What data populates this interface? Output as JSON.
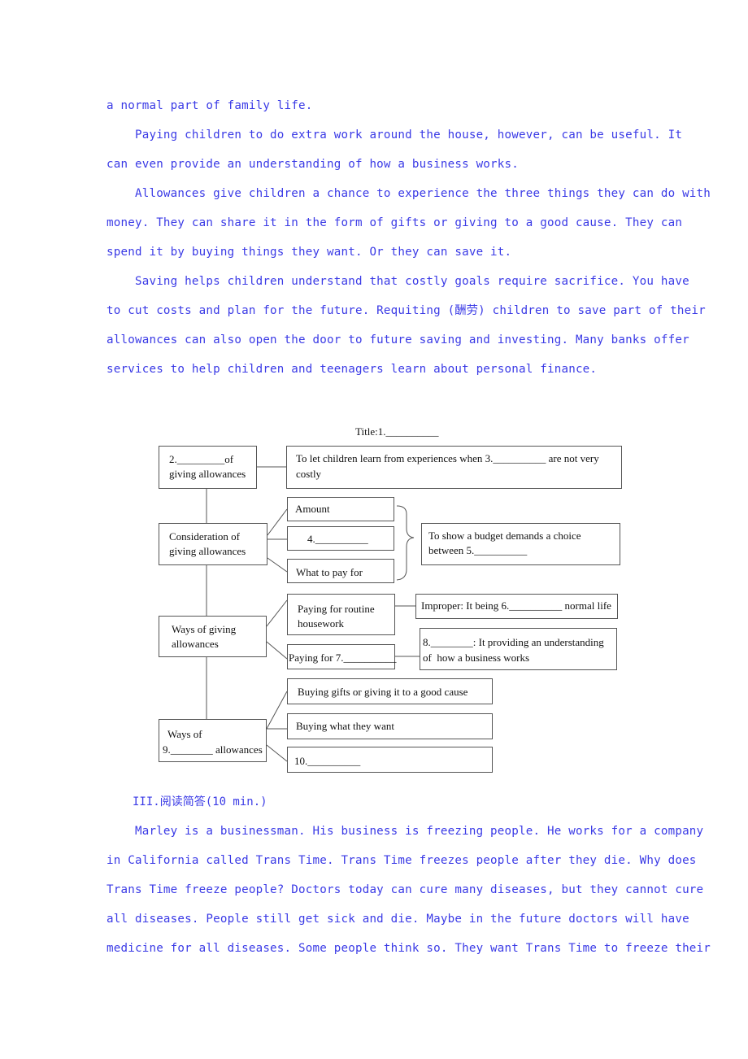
{
  "passage1": {
    "lines": [
      "a normal part of family life.",
      "    Paying children to do extra work around the house, however, can be useful. It",
      "can even provide an understanding of how a business works.",
      "    Allowances give children a chance to experience the three things they can do with",
      "money. They can share it in the form of gifts or giving to a good cause. They can",
      "spend it by buying things they want. Or they can save it.",
      "    Saving helps children understand that costly goals require sacrifice. You have",
      "to cut costs and plan for the future. Requiting (酬劳) children to save part of their",
      "allowances can also open the door to future saving and investing. Many banks offer",
      "services to help children and teenagers learn about personal finance."
    ]
  },
  "diagram": {
    "title": "Title:1.__________",
    "purpose_box": {
      "line1": "2._________of",
      "line2": "giving allowances"
    },
    "purpose_detail": {
      "line1": "To let children learn from experiences when 3.__________ are not very",
      "line2": "costly"
    },
    "consideration_box": {
      "line1": "Consideration of",
      "line2": "giving allowances"
    },
    "consideration_items": [
      "Amount",
      "4.__________",
      "What to pay for"
    ],
    "budget_box": {
      "line1": "To show a budget demands a choice",
      "line2": "between 5.__________"
    },
    "ways_box": {
      "line1": "Ways of giving",
      "line2": "allowances"
    },
    "routine_box": {
      "line1": "Paying for routine",
      "line2": "housework"
    },
    "paying_extra_box": "Paying for 7.__________",
    "improper_box": "Improper: It being 6.__________ normal life",
    "business_box": {
      "line1": "8.________: It providing an understanding",
      "line2": "of  how a business works"
    },
    "ways9_box": {
      "line1": "Ways of",
      "line2": "9.________ allowances"
    },
    "ways9_items": [
      "Buying gifts or giving it to a good cause",
      "Buying what they want",
      "10.__________"
    ]
  },
  "section3": {
    "heading": "III.阅读简答(10 min.)",
    "lines": [
      "    Marley is a businessman. His business is freezing people. He works for a company",
      "in California called Trans Time. Trans Time freezes people after they die. Why does",
      "Trans Time freeze people? Doctors today can cure many diseases, but they cannot cure",
      "all diseases. People still get sick and die. Maybe in the future doctors will have",
      "medicine for all diseases. Some people think so. They want Trans Time to freeze their"
    ]
  }
}
